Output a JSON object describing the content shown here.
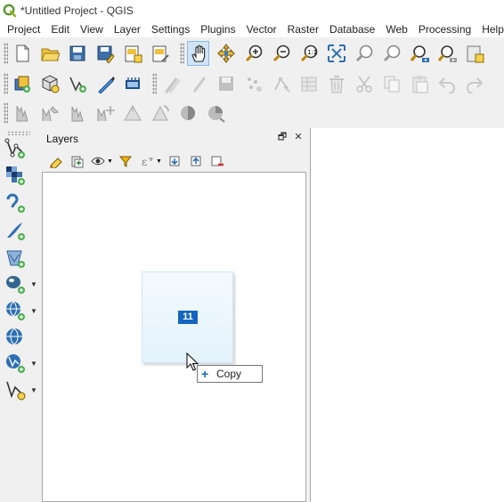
{
  "window": {
    "title": "*Untitled Project - QGIS"
  },
  "menu": [
    "Project",
    "Edit",
    "View",
    "Layer",
    "Settings",
    "Plugins",
    "Vector",
    "Raster",
    "Database",
    "Web",
    "Processing",
    "Help"
  ],
  "toolbar1": [
    {
      "name": "new-project-icon",
      "active": false
    },
    {
      "name": "open-project-icon",
      "active": false
    },
    {
      "name": "save-project-icon",
      "active": false
    },
    {
      "name": "save-as-icon",
      "active": false
    },
    {
      "name": "new-layout-icon",
      "active": false
    },
    {
      "name": "layout-manager-icon",
      "active": false
    },
    {
      "name": "pan-hand-icon",
      "active": true
    },
    {
      "name": "pan-to-selection-icon",
      "active": false
    },
    {
      "name": "zoom-in-icon",
      "active": false
    },
    {
      "name": "zoom-out-icon",
      "active": false
    },
    {
      "name": "zoom-native-icon",
      "active": false
    },
    {
      "name": "zoom-full-icon",
      "active": false
    },
    {
      "name": "zoom-selection-icon",
      "active": false
    },
    {
      "name": "zoom-layer-icon",
      "active": false
    },
    {
      "name": "zoom-last-icon",
      "active": false
    },
    {
      "name": "zoom-next-icon",
      "active": false
    },
    {
      "name": "new-map-view-icon",
      "active": false
    }
  ],
  "toolbar2": [
    {
      "name": "data-source-manager-icon",
      "disabled": false
    },
    {
      "name": "new-geopackage-layer-icon",
      "disabled": false
    },
    {
      "name": "new-shapefile-layer-icon",
      "disabled": false
    },
    {
      "name": "digitize-icon",
      "disabled": false
    },
    {
      "name": "gps-icon",
      "disabled": false
    },
    {
      "name": "current-edits-icon",
      "disabled": true
    },
    {
      "name": "toggle-editing-icon",
      "disabled": true
    },
    {
      "name": "save-edits-icon",
      "disabled": true
    },
    {
      "name": "add-point-icon",
      "disabled": true
    },
    {
      "name": "vertex-tool-icon",
      "disabled": true
    },
    {
      "name": "modify-attributes-icon",
      "disabled": true
    },
    {
      "name": "delete-selected-icon",
      "disabled": true
    },
    {
      "name": "cut-features-icon",
      "disabled": true
    },
    {
      "name": "copy-features-icon",
      "disabled": true
    },
    {
      "name": "paste-features-icon",
      "disabled": true
    },
    {
      "name": "undo-icon",
      "disabled": true
    },
    {
      "name": "redo-icon",
      "disabled": true
    }
  ],
  "toolbar3": [
    {
      "name": "label-icon"
    },
    {
      "name": "label-pin-icon"
    },
    {
      "name": "label-show-hide-icon"
    },
    {
      "name": "label-move-icon"
    },
    {
      "name": "diagram-move-icon"
    },
    {
      "name": "label-rotate-icon"
    },
    {
      "name": "label-change-icon"
    },
    {
      "name": "diagram-rotate-icon"
    }
  ],
  "left_toolbar": [
    {
      "name": "add-vector-layer-icon",
      "dropdown": false
    },
    {
      "name": "add-raster-layer-icon",
      "dropdown": false
    },
    {
      "name": "add-mesh-layer-icon",
      "dropdown": false
    },
    {
      "name": "add-delimited-text-icon",
      "dropdown": false
    },
    {
      "name": "add-spatialite-icon",
      "dropdown": false
    },
    {
      "name": "add-postgis-icon",
      "dropdown": true
    },
    {
      "name": "add-wms-icon",
      "dropdown": true
    },
    {
      "name": "add-wcs-icon",
      "dropdown": false
    },
    {
      "name": "add-wfs-icon",
      "dropdown": true
    },
    {
      "name": "new-virtual-layer-icon",
      "dropdown": true
    }
  ],
  "layers_panel": {
    "title": "Layers",
    "float_glyph": "🗗",
    "close_glyph": "✕",
    "tools": [
      "layer-styling-icon",
      "add-group-icon",
      "manage-visibility-icon",
      "filter-legend-icon",
      "filter-expression-icon",
      "expand-all-icon",
      "collapse-all-icon",
      "remove-layer-icon"
    ]
  },
  "drag": {
    "count": "11",
    "tooltip_symbol": "+",
    "tooltip_label": "Copy"
  }
}
